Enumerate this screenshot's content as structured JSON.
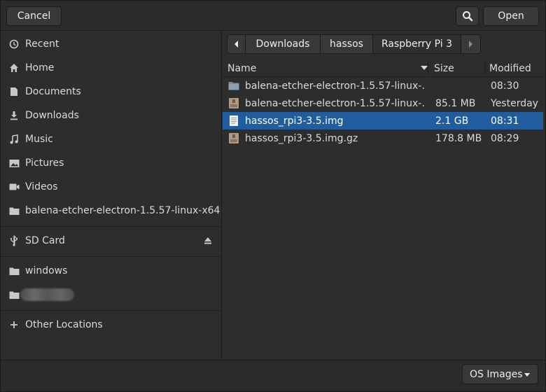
{
  "header": {
    "cancel_label": "Cancel",
    "open_label": "Open",
    "search_icon": "search-icon"
  },
  "sidebar": {
    "items": [
      {
        "label": "Recent",
        "icon": "clock-icon"
      },
      {
        "label": "Home",
        "icon": "home-icon"
      },
      {
        "label": "Documents",
        "icon": "document-icon"
      },
      {
        "label": "Downloads",
        "icon": "download-icon"
      },
      {
        "label": "Music",
        "icon": "music-icon"
      },
      {
        "label": "Pictures",
        "icon": "picture-icon"
      },
      {
        "label": "Videos",
        "icon": "video-icon"
      },
      {
        "label": "balena-etcher-electron-1.5.57-linux-x64",
        "icon": "folder-icon"
      }
    ],
    "devices": [
      {
        "label": "SD Card",
        "icon": "usb-icon"
      }
    ],
    "bookmarks": [
      {
        "label": "windows",
        "icon": "folder-icon"
      },
      {
        "label": "",
        "icon": "folder-icon"
      }
    ],
    "other_locations_label": "Other Locations"
  },
  "pathbar": {
    "segments": [
      "Downloads",
      "hassos",
      "Raspberry Pi 3"
    ],
    "active_index": 2
  },
  "filelist": {
    "columns": {
      "name": "Name",
      "size": "Size",
      "modified": "Modified"
    },
    "rows": [
      {
        "name": "balena-etcher-electron-1.5.57-linux-…",
        "size": "",
        "modified": "08:30",
        "type": "folder"
      },
      {
        "name": "balena-etcher-electron-1.5.57-linux-…",
        "size": "85.1 MB",
        "modified": "Yesterday",
        "type": "archive"
      },
      {
        "name": "hassos_rpi3-3.5.img",
        "size": "2.1 GB",
        "modified": "08:31",
        "type": "text",
        "selected": true
      },
      {
        "name": "hassos_rpi3-3.5.img.gz",
        "size": "178.8 MB",
        "modified": "08:29",
        "type": "archive"
      }
    ]
  },
  "footer": {
    "filter_label": "OS Images"
  },
  "colors": {
    "selection": "#215d9c",
    "background": "#2d2d2d"
  }
}
